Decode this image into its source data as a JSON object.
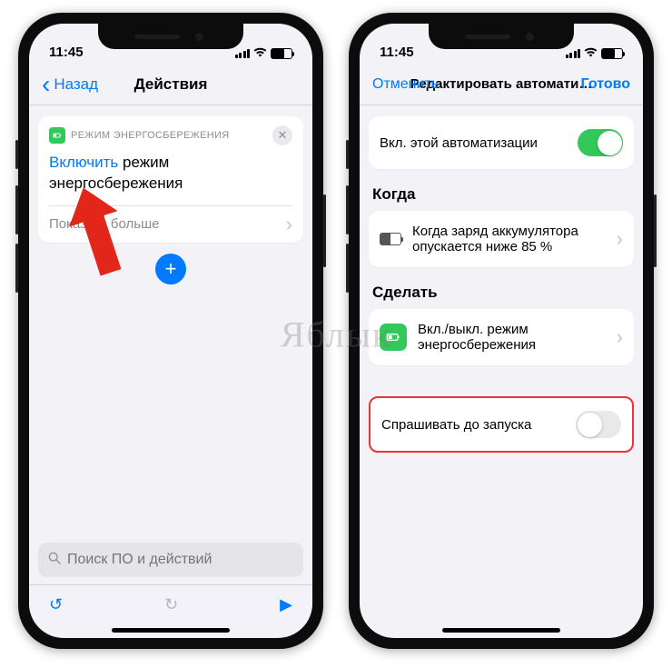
{
  "status": {
    "time": "11:45"
  },
  "left": {
    "nav": {
      "back": "Назад",
      "title": "Действия"
    },
    "block": {
      "header": "РЕЖИМ ЭНЕРГОСБЕРЕЖЕНИЯ",
      "keyword": "Включить",
      "rest": "режим энергосбережения",
      "show_more": "Показать больше"
    },
    "search_placeholder": "Поиск ПО и действий"
  },
  "right": {
    "nav": {
      "cancel": "Отменить",
      "title": "Редактировать автомати…",
      "done": "Готово"
    },
    "enable_row": "Вкл. этой автоматизации",
    "when_label": "Когда",
    "when_row": "Когда заряд аккумулятора опускается ниже 85 %",
    "do_label": "Сделать",
    "do_row": "Вкл./выкл. режим энергосбережения",
    "ask_row": "Спрашивать до запуска"
  },
  "watermark": "Яблык"
}
